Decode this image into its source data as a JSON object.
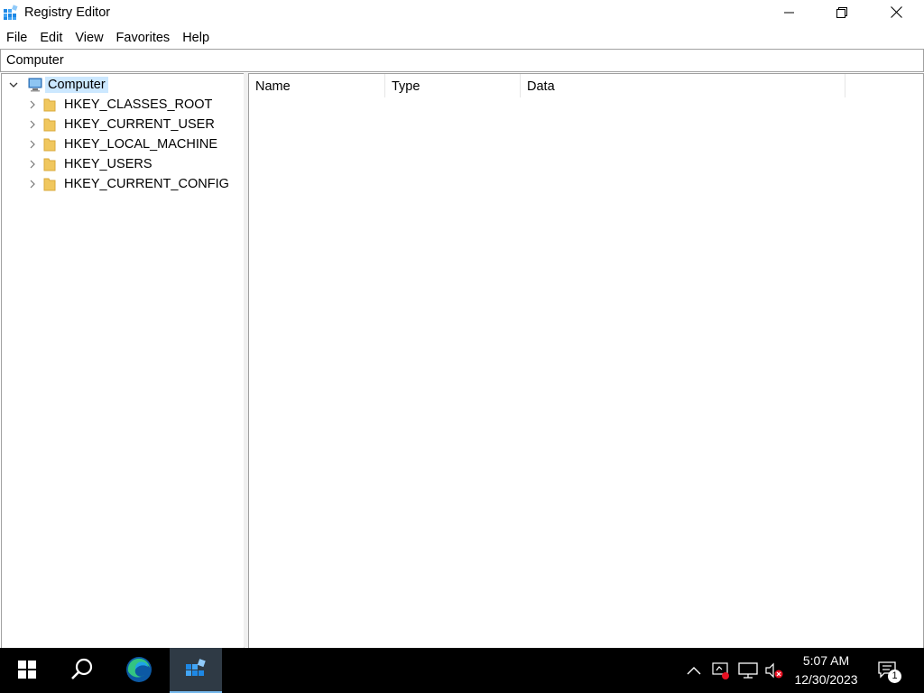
{
  "window": {
    "title": "Registry Editor",
    "icon": "regedit-icon",
    "controls": [
      "minimize-icon",
      "restore-icon",
      "close-icon"
    ]
  },
  "menu": {
    "items": [
      "File",
      "Edit",
      "View",
      "Favorites",
      "Help"
    ]
  },
  "address": {
    "value": "Computer"
  },
  "tree": {
    "root": {
      "label": "Computer",
      "icon": "computer-icon",
      "expanded": true,
      "selected": true
    },
    "keys": [
      {
        "label": "HKEY_CLASSES_ROOT",
        "icon": "folder-icon"
      },
      {
        "label": "HKEY_CURRENT_USER",
        "icon": "folder-icon"
      },
      {
        "label": "HKEY_LOCAL_MACHINE",
        "icon": "folder-icon"
      },
      {
        "label": "HKEY_USERS",
        "icon": "folder-icon"
      },
      {
        "label": "HKEY_CURRENT_CONFIG",
        "icon": "folder-icon"
      }
    ]
  },
  "list": {
    "columns": [
      "Name",
      "Type",
      "Data"
    ]
  },
  "taskbar": {
    "buttons": [
      "start-icon",
      "search-icon",
      "edge-icon",
      "regedit-icon"
    ],
    "active": "regedit-icon",
    "tray_icons": [
      "chevron-up-icon",
      "network-alert-icon",
      "display-icon",
      "volume-muted-icon"
    ],
    "time": "5:07 AM",
    "date": "12/30/2023",
    "notification_count": "1"
  },
  "colors": {
    "selection": "#cce8ff",
    "folder": "#f0c75e",
    "taskbar": "#000000",
    "accent": "#76b9ed",
    "alert": "#e81123"
  }
}
